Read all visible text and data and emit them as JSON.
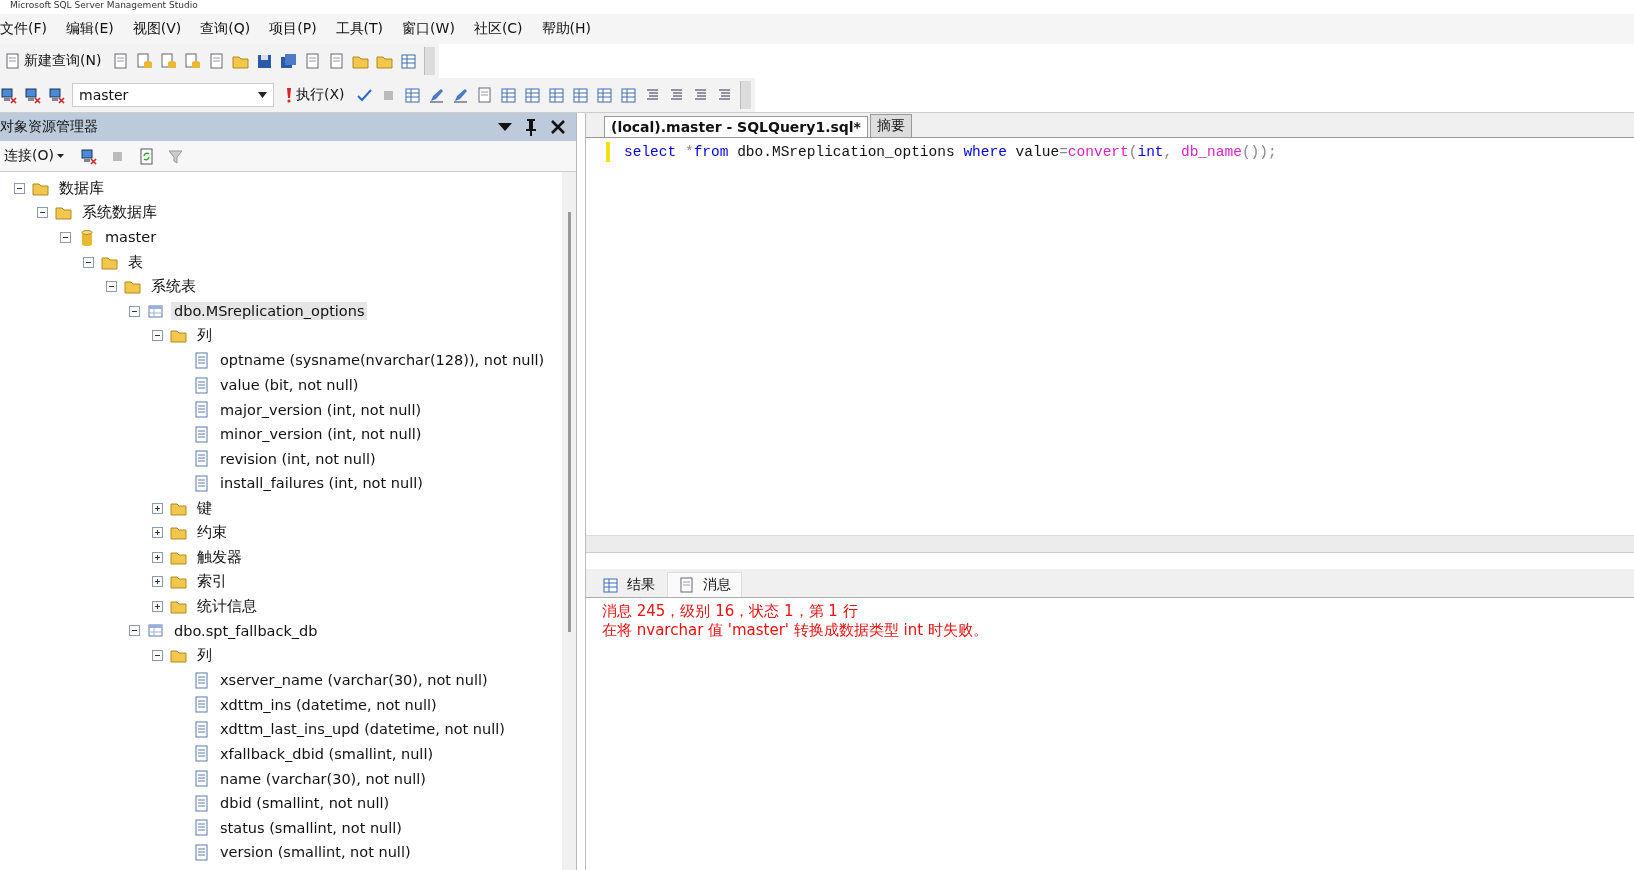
{
  "window": {
    "title": "Microsoft SQL Server Management Studio"
  },
  "menu": [
    "文件(F)",
    "编辑(E)",
    "视图(V)",
    "查询(Q)",
    "项目(P)",
    "工具(T)",
    "窗口(W)",
    "社区(C)",
    "帮助(H)"
  ],
  "toolbar": {
    "new_query": "新建查询(N)",
    "database": "master",
    "execute": "执行(X)"
  },
  "explorer": {
    "title": "对象资源管理器",
    "connect": "连接(O)",
    "tree": [
      {
        "label": "数据库",
        "kind": "folder",
        "expanded": true,
        "selected": false,
        "children": [
          {
            "label": "系统数据库",
            "kind": "folder",
            "expanded": true,
            "selected": false,
            "children": [
              {
                "label": "master",
                "kind": "database",
                "expanded": true,
                "selected": false,
                "children": [
                  {
                    "label": "表",
                    "kind": "folder",
                    "expanded": true,
                    "selected": false,
                    "children": [
                      {
                        "label": "系统表",
                        "kind": "folder",
                        "expanded": true,
                        "selected": false,
                        "children": [
                          {
                            "label": "dbo.MSreplication_options",
                            "kind": "table",
                            "expanded": true,
                            "selected": true,
                            "children": [
                              {
                                "label": "列",
                                "kind": "folder",
                                "expanded": true,
                                "selected": false,
                                "children": [
                                  {
                                    "label": "optname (sysname(nvarchar(128)), not null)",
                                    "kind": "column",
                                    "selected": false
                                  },
                                  {
                                    "label": "value (bit, not null)",
                                    "kind": "column",
                                    "selected": false
                                  },
                                  {
                                    "label": "major_version (int, not null)",
                                    "kind": "column",
                                    "selected": false
                                  },
                                  {
                                    "label": "minor_version (int, not null)",
                                    "kind": "column",
                                    "selected": false
                                  },
                                  {
                                    "label": "revision (int, not null)",
                                    "kind": "column",
                                    "selected": false
                                  },
                                  {
                                    "label": "install_failures (int, not null)",
                                    "kind": "column",
                                    "selected": false
                                  }
                                ]
                              },
                              {
                                "label": "键",
                                "kind": "folder",
                                "expanded": false,
                                "selected": false
                              },
                              {
                                "label": "约束",
                                "kind": "folder",
                                "expanded": false,
                                "selected": false
                              },
                              {
                                "label": "触发器",
                                "kind": "folder",
                                "expanded": false,
                                "selected": false
                              },
                              {
                                "label": "索引",
                                "kind": "folder",
                                "expanded": false,
                                "selected": false
                              },
                              {
                                "label": "统计信息",
                                "kind": "folder",
                                "expanded": false,
                                "selected": false
                              }
                            ]
                          },
                          {
                            "label": "dbo.spt_fallback_db",
                            "kind": "table",
                            "expanded": true,
                            "selected": false,
                            "children": [
                              {
                                "label": "列",
                                "kind": "folder",
                                "expanded": true,
                                "selected": false,
                                "children": [
                                  {
                                    "label": "xserver_name (varchar(30), not null)",
                                    "kind": "column",
                                    "selected": false
                                  },
                                  {
                                    "label": "xdttm_ins (datetime, not null)",
                                    "kind": "column",
                                    "selected": false
                                  },
                                  {
                                    "label": "xdttm_last_ins_upd (datetime, not null)",
                                    "kind": "column",
                                    "selected": false
                                  },
                                  {
                                    "label": "xfallback_dbid (smallint, null)",
                                    "kind": "column",
                                    "selected": false
                                  },
                                  {
                                    "label": "name (varchar(30), not null)",
                                    "kind": "column",
                                    "selected": false
                                  },
                                  {
                                    "label": "dbid (smallint, not null)",
                                    "kind": "column",
                                    "selected": false
                                  },
                                  {
                                    "label": "status (smallint, not null)",
                                    "kind": "column",
                                    "selected": false
                                  },
                                  {
                                    "label": "version (smallint, not null)",
                                    "kind": "column",
                                    "selected": false
                                  }
                                ]
                              }
                            ]
                          }
                        ]
                      }
                    ]
                  }
                ]
              }
            ]
          }
        ]
      }
    ]
  },
  "editor": {
    "tabs": [
      {
        "label": "(local).master - SQLQuery1.sql*",
        "selected": true
      },
      {
        "label": "摘要",
        "selected": false
      }
    ],
    "code": [
      {
        "kind": "keyword",
        "text": "select "
      },
      {
        "kind": "operator",
        "text": "*"
      },
      {
        "kind": "keyword",
        "text": "from "
      },
      {
        "kind": "plain",
        "text": "dbo.MSreplication_options "
      },
      {
        "kind": "keyword",
        "text": "where "
      },
      {
        "kind": "plain",
        "text": "value"
      },
      {
        "kind": "operator",
        "text": "="
      },
      {
        "kind": "function",
        "text": "convert"
      },
      {
        "kind": "operator",
        "text": "("
      },
      {
        "kind": "keyword",
        "text": "int"
      },
      {
        "kind": "operator",
        "text": ", "
      },
      {
        "kind": "function",
        "text": "db_name"
      },
      {
        "kind": "operator",
        "text": "());"
      }
    ]
  },
  "results": {
    "tabs": [
      {
        "label": "结果",
        "selected": false
      },
      {
        "label": "消息",
        "selected": true
      }
    ],
    "messages": [
      "消息 245，级别 16，状态 1，第 1 行",
      "在将 nvarchar 值 'master' 转换成数据类型 int 时失败。"
    ]
  }
}
